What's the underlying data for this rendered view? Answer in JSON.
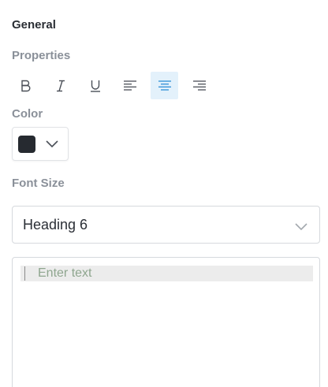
{
  "panel": {
    "section_title": "General",
    "properties_label": "Properties",
    "color_label": "Color",
    "font_size_label": "Font Size"
  },
  "toolbar": {
    "buttons": [
      {
        "name": "bold",
        "icon": "bold-icon",
        "active": false
      },
      {
        "name": "italic",
        "icon": "italic-icon",
        "active": false
      },
      {
        "name": "underline",
        "icon": "underline-icon",
        "active": false
      },
      {
        "name": "align-left",
        "icon": "align-left-icon",
        "active": false
      },
      {
        "name": "align-center",
        "icon": "align-center-icon",
        "active": true
      },
      {
        "name": "align-right",
        "icon": "align-right-icon",
        "active": false
      }
    ]
  },
  "color": {
    "value": "#262a30",
    "chevron_icon": "chevron-down-icon"
  },
  "font_size": {
    "selected": "Heading 6",
    "chevron_icon": "chevron-down-icon"
  },
  "text_input": {
    "placeholder": "Enter text"
  },
  "colors": {
    "accent": "#2e8fd6",
    "active_bg": "#e3f1fb",
    "icon": "#4a4f57"
  }
}
